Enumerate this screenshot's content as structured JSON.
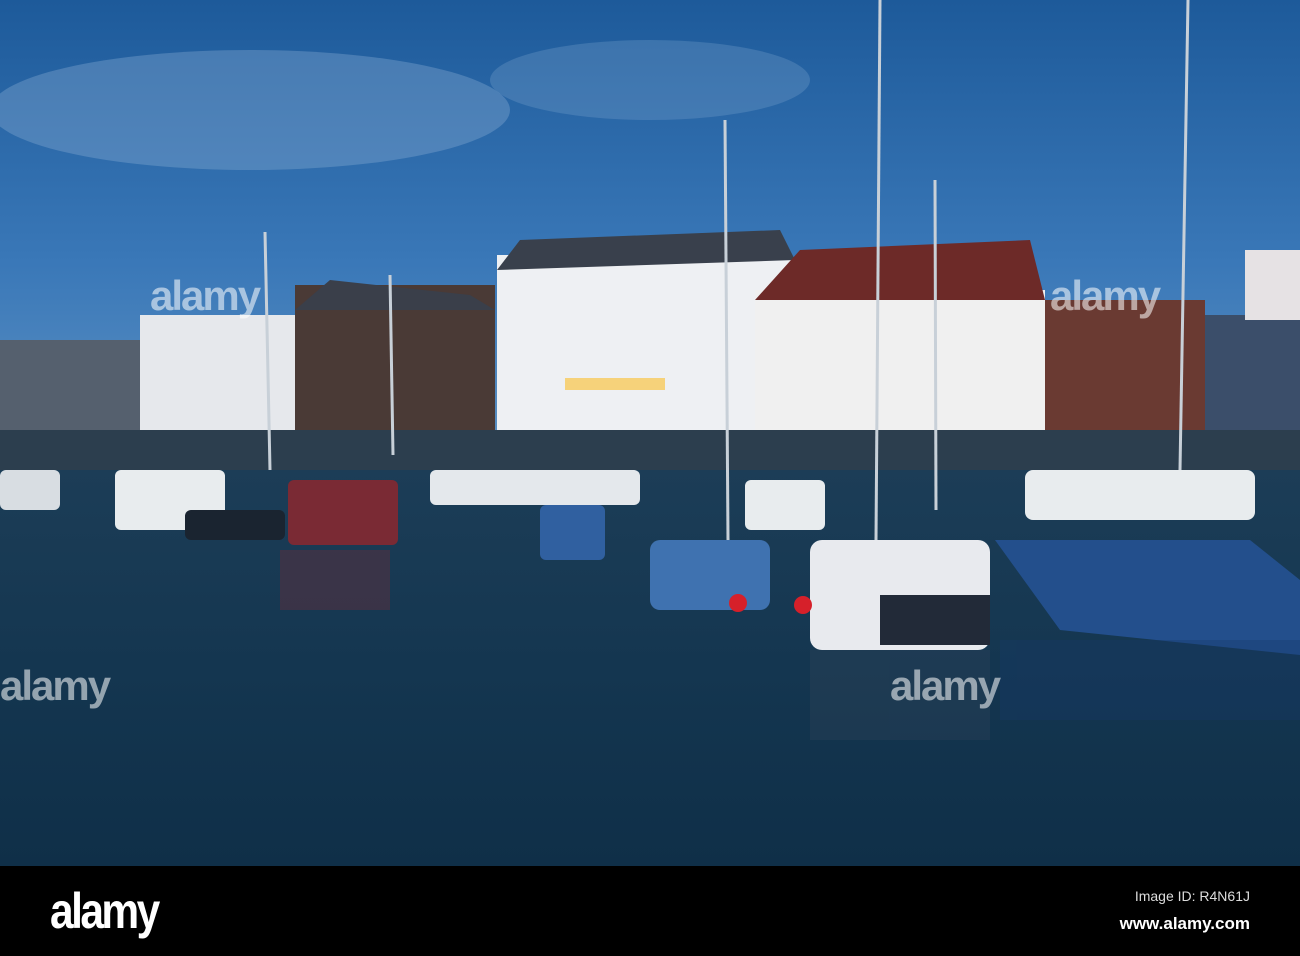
{
  "photo": {
    "subject": "harbour marina at dusk"
  },
  "watermark": {
    "text": "alamy"
  },
  "footer": {
    "logo": "alamy",
    "image_id": "Image ID: R4N61J",
    "website": "www.alamy.com"
  }
}
